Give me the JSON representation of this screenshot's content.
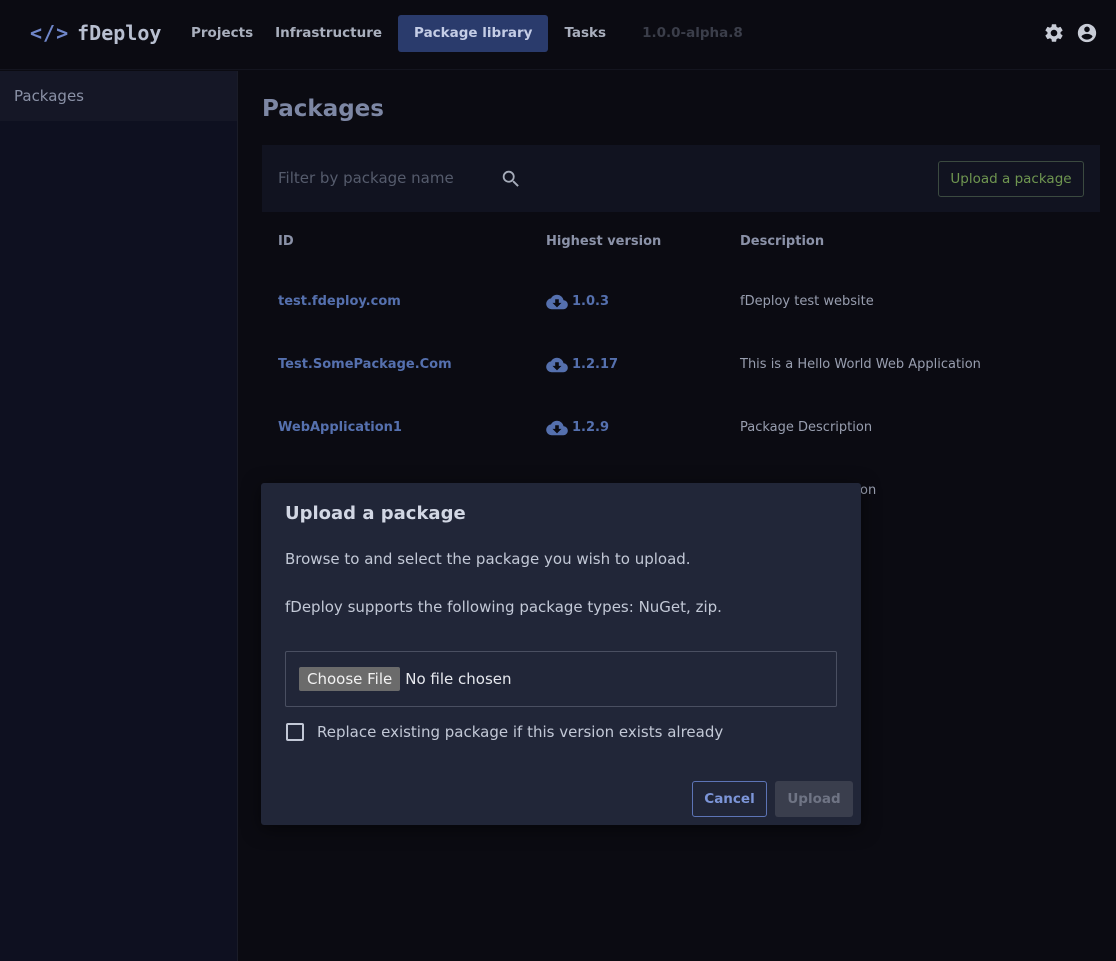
{
  "app": {
    "logo_icon": "</>",
    "logo_text": "fDeploy",
    "version": "1.0.0-alpha.8"
  },
  "nav": {
    "items": [
      {
        "label": "Projects"
      },
      {
        "label": "Infrastructure"
      },
      {
        "label": "Package library"
      },
      {
        "label": "Tasks"
      }
    ],
    "active_index": 2
  },
  "top_icons": [
    "gear-icon",
    "account-circle-icon"
  ],
  "sidebar": {
    "items": [
      {
        "label": "Packages"
      }
    ]
  },
  "main": {
    "title": "Packages",
    "filter": {
      "placeholder": "Filter by package name",
      "value": ""
    },
    "upload_button": "Upload a package",
    "table": {
      "headers": {
        "id": "ID",
        "version": "Highest version",
        "description": "Description"
      },
      "rows": [
        {
          "id": "test.fdeploy.com",
          "version": "1.0.3",
          "description": "fDeploy test website"
        },
        {
          "id": "Test.SomePackage.Com",
          "version": "1.2.17",
          "description": "This is a Hello World Web Application"
        },
        {
          "id": "WebApplication1",
          "version": "1.2.9",
          "description": "Package Description"
        }
      ],
      "partial_row_text": "on"
    }
  },
  "modal": {
    "title": "Upload a package",
    "text1": "Browse to and select the package you wish to upload.",
    "text2": "fDeploy supports the following package types: NuGet, zip.",
    "choose_file": "Choose File",
    "no_file": "No file chosen",
    "checkbox_label": "Replace existing package if this version exists already",
    "checkbox_checked": false,
    "cancel": "Cancel",
    "upload": "Upload"
  },
  "colors": {
    "accent": "#2a3b6c",
    "link": "#5570ae",
    "upload_button_text": "#6f9650",
    "background": "#0b0b12"
  }
}
